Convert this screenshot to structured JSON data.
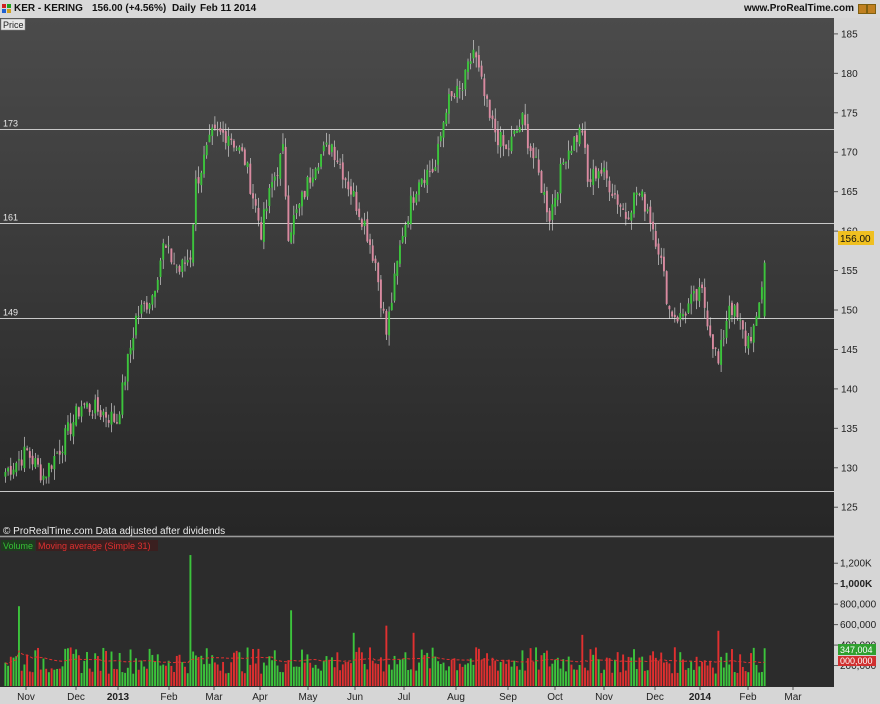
{
  "header": {
    "symbol": "KER - KERING",
    "last": "156.00 (+4.56%)",
    "period": "Daily",
    "date": "Feb 11 2014",
    "brand": "www.ProRealTime.com"
  },
  "panels": {
    "price_label": "Price",
    "copyright": "© ProRealTime.com  Data adjusted after dividends",
    "volume_legend": "Volume",
    "ma_legend": "Moving average (Simple 31)"
  },
  "levels": [
    {
      "label": "173",
      "value": 173
    },
    {
      "label": "161",
      "value": 161
    },
    {
      "label": "149",
      "value": 149
    }
  ],
  "support_level": 127,
  "current_price_tag": "156.00",
  "volume_tags": {
    "ma": "347,004",
    "last": "000,000"
  },
  "colors": {
    "up": "#3cc43c",
    "down": "#d98aa0",
    "level_line": "#c8c8c8",
    "ma": "#e03030",
    "price_tag": "#f0c020",
    "bg_top": "#4b4b4b",
    "bg_bottom": "#262626"
  },
  "chart_data": {
    "type": "candlestick",
    "y_ticks": [
      185,
      180,
      175,
      170,
      165,
      160,
      155,
      150,
      145,
      140,
      135,
      130,
      125
    ],
    "y_range": [
      123,
      186
    ],
    "volume_ticks": [
      "1,200K",
      "1,000K",
      "800,000",
      "600,000",
      "400,000",
      "200,000"
    ],
    "volume_range": [
      0,
      1300000
    ],
    "x_labels": [
      "Nov",
      "Dec",
      "2013",
      "Feb",
      "Mar",
      "Apr",
      "May",
      "Jun",
      "Jul",
      "Aug",
      "Sep",
      "Oct",
      "Nov",
      "Dec",
      "2014",
      "Feb",
      "Mar"
    ],
    "close_anchors": [
      [
        0,
        129.5
      ],
      [
        8,
        132
      ],
      [
        14,
        129
      ],
      [
        20,
        132.5
      ],
      [
        28,
        138
      ],
      [
        36,
        137
      ],
      [
        41,
        136
      ],
      [
        48,
        149
      ],
      [
        54,
        152
      ],
      [
        58,
        158
      ],
      [
        64,
        155
      ],
      [
        68,
        157
      ],
      [
        70,
        166
      ],
      [
        76,
        172
      ],
      [
        82,
        172.5
      ],
      [
        88,
        169
      ],
      [
        94,
        160
      ],
      [
        98,
        166
      ],
      [
        102,
        170
      ],
      [
        104,
        160
      ],
      [
        108,
        163
      ],
      [
        114,
        169
      ],
      [
        120,
        171
      ],
      [
        126,
        166
      ],
      [
        132,
        161
      ],
      [
        136,
        156
      ],
      [
        140,
        147
      ],
      [
        146,
        160
      ],
      [
        152,
        167
      ],
      [
        158,
        168
      ],
      [
        162,
        176
      ],
      [
        168,
        178
      ],
      [
        172,
        183
      ],
      [
        178,
        174
      ],
      [
        184,
        170
      ],
      [
        190,
        174
      ],
      [
        196,
        167
      ],
      [
        200,
        162
      ],
      [
        206,
        170
      ],
      [
        212,
        173
      ],
      [
        214,
        166
      ],
      [
        218,
        168
      ],
      [
        222,
        166
      ],
      [
        228,
        162
      ],
      [
        232,
        165
      ],
      [
        236,
        163
      ],
      [
        240,
        158
      ],
      [
        244,
        150
      ],
      [
        248,
        149
      ],
      [
        252,
        151
      ],
      [
        256,
        152
      ],
      [
        260,
        146
      ],
      [
        262,
        143
      ],
      [
        266,
        151
      ],
      [
        270,
        148
      ],
      [
        272,
        146
      ],
      [
        276,
        148
      ],
      [
        279,
        156
      ]
    ],
    "volume_spikes": [
      {
        "i": 5,
        "v": 780000
      },
      {
        "i": 68,
        "v": 1280000
      },
      {
        "i": 105,
        "v": 740000
      },
      {
        "i": 128,
        "v": 520000
      },
      {
        "i": 140,
        "v": 590000
      },
      {
        "i": 150,
        "v": 520000
      },
      {
        "i": 212,
        "v": 500000
      },
      {
        "i": 262,
        "v": 540000
      }
    ]
  }
}
